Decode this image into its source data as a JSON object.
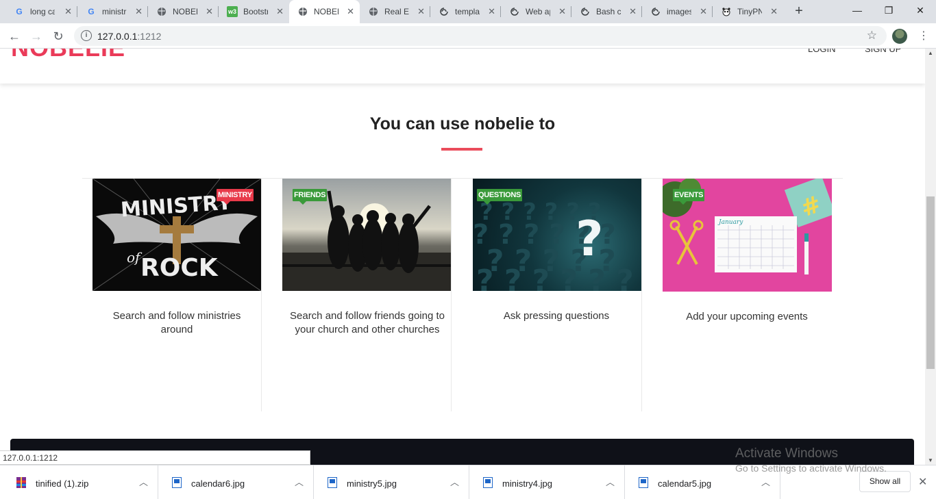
{
  "browser": {
    "tabs": [
      {
        "title": "long ca",
        "icon": "google-icon"
      },
      {
        "title": "ministr",
        "icon": "google-icon"
      },
      {
        "title": "NOBEL",
        "icon": "globe-icon"
      },
      {
        "title": "Bootstr",
        "icon": "w3schools-icon"
      },
      {
        "title": "NOBEL",
        "icon": "globe-icon",
        "active": true
      },
      {
        "title": "Real Es",
        "icon": "globe-icon"
      },
      {
        "title": "templa",
        "icon": "spiral-icon"
      },
      {
        "title": "Web ap",
        "icon": "spiral-icon"
      },
      {
        "title": "Bash c",
        "icon": "spiral-icon"
      },
      {
        "title": "images",
        "icon": "spiral-icon"
      },
      {
        "title": "TinyPN",
        "icon": "panda-icon"
      }
    ],
    "url_host": "127.0.0.1",
    "url_port": ":1212",
    "status_url": "127.0.0.1:1212"
  },
  "header": {
    "logo": "NOBELIE",
    "login": "LOGIN",
    "signup": "SIGN UP"
  },
  "section": {
    "title": "You can use nobelie to"
  },
  "cards": [
    {
      "badge": "MINISTRY",
      "badge_color": "#e83a4a",
      "text": "Search and follow ministries around",
      "image": "ministry-of-rock"
    },
    {
      "badge": "FRIENDS",
      "badge_color": "#3a9a3a",
      "text": "Search and follow friends going to your church and other churches",
      "image": "friends-silhouette"
    },
    {
      "badge": "QUESTIONS",
      "badge_color": "#3a9a3a",
      "text": "Ask pressing questions",
      "image": "question-marks"
    },
    {
      "badge": "EVENTS",
      "badge_color": "#3a9a3a",
      "text": "Add your upcoming events",
      "image": "calendar-desk"
    }
  ],
  "calendar_month": "January",
  "watermark": {
    "title": "Activate Windows",
    "subtitle": "Go to Settings to activate Windows."
  },
  "downloads": [
    {
      "name": "tinified (1).zip",
      "icon": "zip-icon"
    },
    {
      "name": "calendar6.jpg",
      "icon": "image-file-icon"
    },
    {
      "name": "ministry5.jpg",
      "icon": "image-file-icon"
    },
    {
      "name": "ministry4.jpg",
      "icon": "image-file-icon"
    },
    {
      "name": "calendar5.jpg",
      "icon": "image-file-icon"
    }
  ],
  "show_all": "Show all",
  "colors": {
    "brand": "#ea3b59",
    "underline": "#ea4c5b",
    "footer": "#0f1118"
  }
}
